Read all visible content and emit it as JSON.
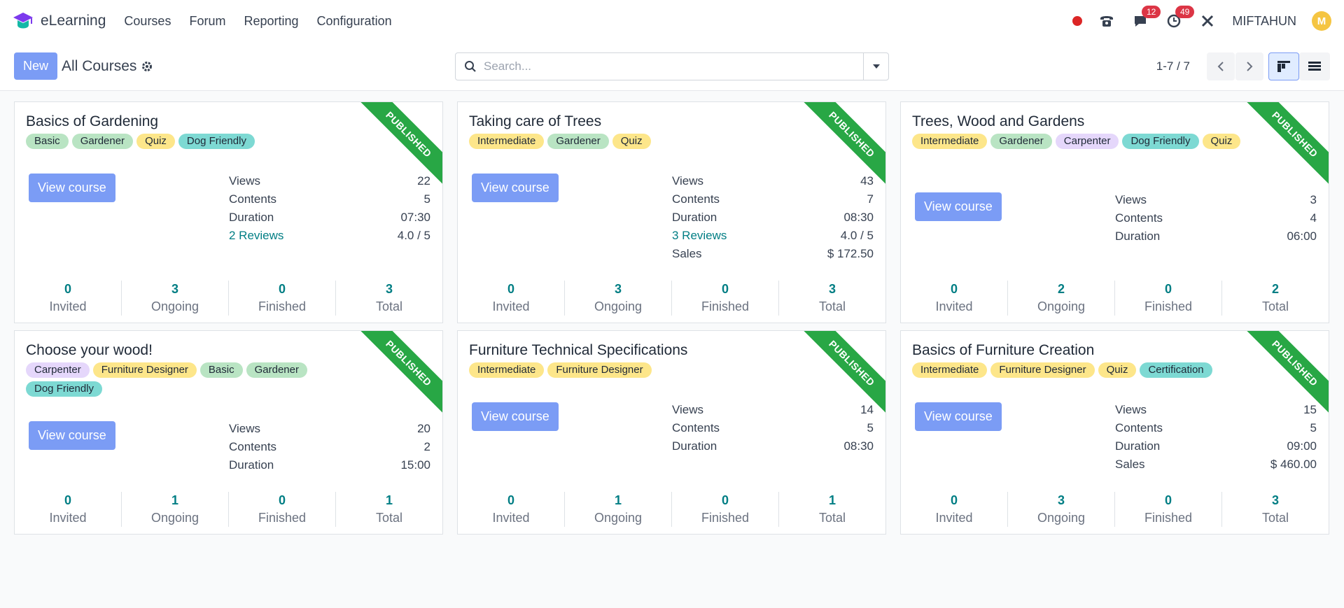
{
  "navbar": {
    "app_name": "eLearning",
    "menu": [
      "Courses",
      "Forum",
      "Reporting",
      "Configuration"
    ],
    "messages_count": "12",
    "activities_count": "49",
    "user_name": "MIFTAHUN",
    "avatar_letter": "M"
  },
  "control": {
    "new_label": "New",
    "title": "All Courses",
    "search_placeholder": "Search...",
    "pager": "1-7 / 7"
  },
  "colors": {
    "accent": "#7b9cf5",
    "ribbon": "#28a745",
    "teal": "#017e84"
  },
  "courses": [
    {
      "title": "Basics of Gardening",
      "tags": [
        {
          "label": "Basic",
          "color": "green"
        },
        {
          "label": "Gardener",
          "color": "green"
        },
        {
          "label": "Quiz",
          "color": "yellow"
        },
        {
          "label": "Dog Friendly",
          "color": "teal"
        }
      ],
      "ribbon": "PUBLISHED",
      "button": "View course",
      "stats": [
        [
          "Views",
          "22"
        ],
        [
          "Contents",
          "5"
        ],
        [
          "Duration",
          "07:30"
        ],
        [
          "2 Reviews",
          "4.0 / 5"
        ]
      ],
      "counters": [
        [
          "0",
          "Invited"
        ],
        [
          "3",
          "Ongoing"
        ],
        [
          "0",
          "Finished"
        ],
        [
          "3",
          "Total"
        ]
      ]
    },
    {
      "title": "Taking care of Trees",
      "tags": [
        {
          "label": "Intermediate",
          "color": "yellow"
        },
        {
          "label": "Gardener",
          "color": "green"
        },
        {
          "label": "Quiz",
          "color": "yellow"
        }
      ],
      "ribbon": "PUBLISHED",
      "button": "View course",
      "stats": [
        [
          "Views",
          "43"
        ],
        [
          "Contents",
          "7"
        ],
        [
          "Duration",
          "08:30"
        ],
        [
          "3 Reviews",
          "4.0 / 5"
        ],
        [
          "Sales",
          "$ 172.50"
        ]
      ],
      "counters": [
        [
          "0",
          "Invited"
        ],
        [
          "3",
          "Ongoing"
        ],
        [
          "0",
          "Finished"
        ],
        [
          "3",
          "Total"
        ]
      ]
    },
    {
      "title": "Trees, Wood and Gardens",
      "tags": [
        {
          "label": "Intermediate",
          "color": "yellow"
        },
        {
          "label": "Gardener",
          "color": "green"
        },
        {
          "label": "Carpenter",
          "color": "purple"
        },
        {
          "label": "Dog Friendly",
          "color": "teal"
        },
        {
          "label": "Quiz",
          "color": "yellow"
        }
      ],
      "ribbon": "PUBLISHED",
      "button": "View course",
      "stats": [
        [
          "Views",
          "3"
        ],
        [
          "Contents",
          "4"
        ],
        [
          "Duration",
          "06:00"
        ]
      ],
      "counters": [
        [
          "0",
          "Invited"
        ],
        [
          "2",
          "Ongoing"
        ],
        [
          "0",
          "Finished"
        ],
        [
          "2",
          "Total"
        ]
      ]
    },
    {
      "title": "Choose your wood!",
      "tags": [
        {
          "label": "Carpenter",
          "color": "purple"
        },
        {
          "label": "Furniture Designer",
          "color": "yellow"
        },
        {
          "label": "Basic",
          "color": "green"
        },
        {
          "label": "Gardener",
          "color": "green"
        },
        {
          "label": "Dog Friendly",
          "color": "teal"
        }
      ],
      "ribbon": "PUBLISHED",
      "button": "View course",
      "stats": [
        [
          "Views",
          "20"
        ],
        [
          "Contents",
          "2"
        ],
        [
          "Duration",
          "15:00"
        ]
      ],
      "counters": [
        [
          "0",
          "Invited"
        ],
        [
          "1",
          "Ongoing"
        ],
        [
          "0",
          "Finished"
        ],
        [
          "1",
          "Total"
        ]
      ]
    },
    {
      "title": "Furniture Technical Specifications",
      "tags": [
        {
          "label": "Intermediate",
          "color": "yellow"
        },
        {
          "label": "Furniture Designer",
          "color": "yellow"
        }
      ],
      "ribbon": "PUBLISHED",
      "button": "View course",
      "stats": [
        [
          "Views",
          "14"
        ],
        [
          "Contents",
          "5"
        ],
        [
          "Duration",
          "08:30"
        ]
      ],
      "counters": [
        [
          "0",
          "Invited"
        ],
        [
          "1",
          "Ongoing"
        ],
        [
          "0",
          "Finished"
        ],
        [
          "1",
          "Total"
        ]
      ]
    },
    {
      "title": "Basics of Furniture Creation",
      "tags": [
        {
          "label": "Intermediate",
          "color": "yellow"
        },
        {
          "label": "Furniture Designer",
          "color": "yellow"
        },
        {
          "label": "Quiz",
          "color": "yellow"
        },
        {
          "label": "Certification",
          "color": "teal"
        }
      ],
      "ribbon": "PUBLISHED",
      "button": "View course",
      "stats": [
        [
          "Views",
          "15"
        ],
        [
          "Contents",
          "5"
        ],
        [
          "Duration",
          "09:00"
        ],
        [
          "Sales",
          "$ 460.00"
        ]
      ],
      "counters": [
        [
          "0",
          "Invited"
        ],
        [
          "3",
          "Ongoing"
        ],
        [
          "0",
          "Finished"
        ],
        [
          "3",
          "Total"
        ]
      ]
    }
  ]
}
